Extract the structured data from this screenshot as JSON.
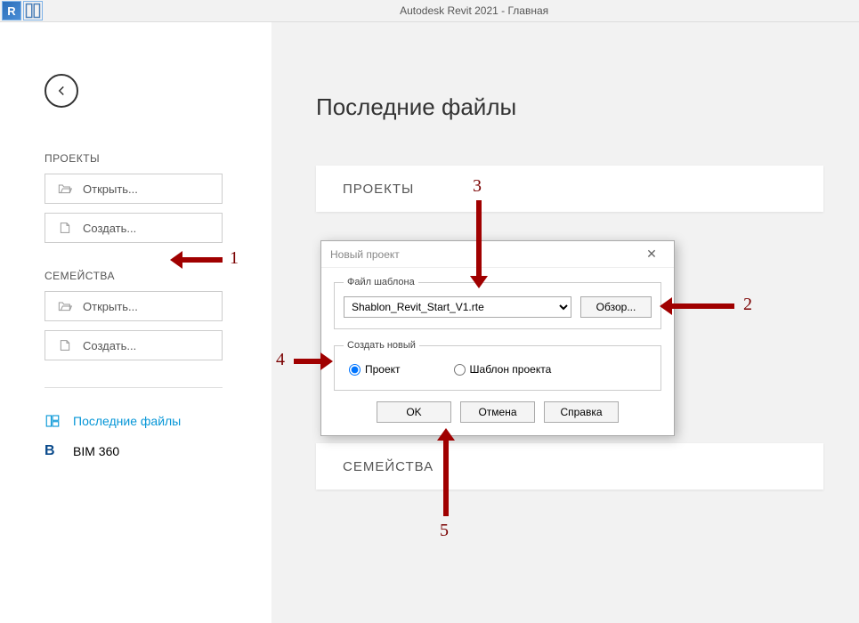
{
  "titlebar": {
    "app_letter": "R",
    "title": "Autodesk Revit 2021 - Главная"
  },
  "sidebar": {
    "projects": {
      "heading": "ПРОЕКТЫ",
      "open": "Открыть...",
      "create": "Создать..."
    },
    "families": {
      "heading": "СЕМЕЙСТВА",
      "open": "Открыть...",
      "create": "Создать..."
    },
    "nav": {
      "recent": "Последние файлы",
      "bim360": "BIM 360"
    }
  },
  "main": {
    "title": "Последние файлы",
    "section_projects": "ПРОЕКТЫ",
    "section_families": "СЕМЕЙСТВА"
  },
  "dialog": {
    "title": "Новый проект",
    "group_template": "Файл шаблона",
    "template_value": "Shablon_Revit_Start_V1.rte",
    "browse": "Обзор...",
    "group_create": "Создать новый",
    "radio_project": "Проект",
    "radio_template": "Шаблон проекта",
    "ok": "OK",
    "cancel": "Отмена",
    "help": "Справка"
  },
  "annotations": {
    "n1": "1",
    "n2": "2",
    "n3": "3",
    "n4": "4",
    "n5": "5"
  }
}
